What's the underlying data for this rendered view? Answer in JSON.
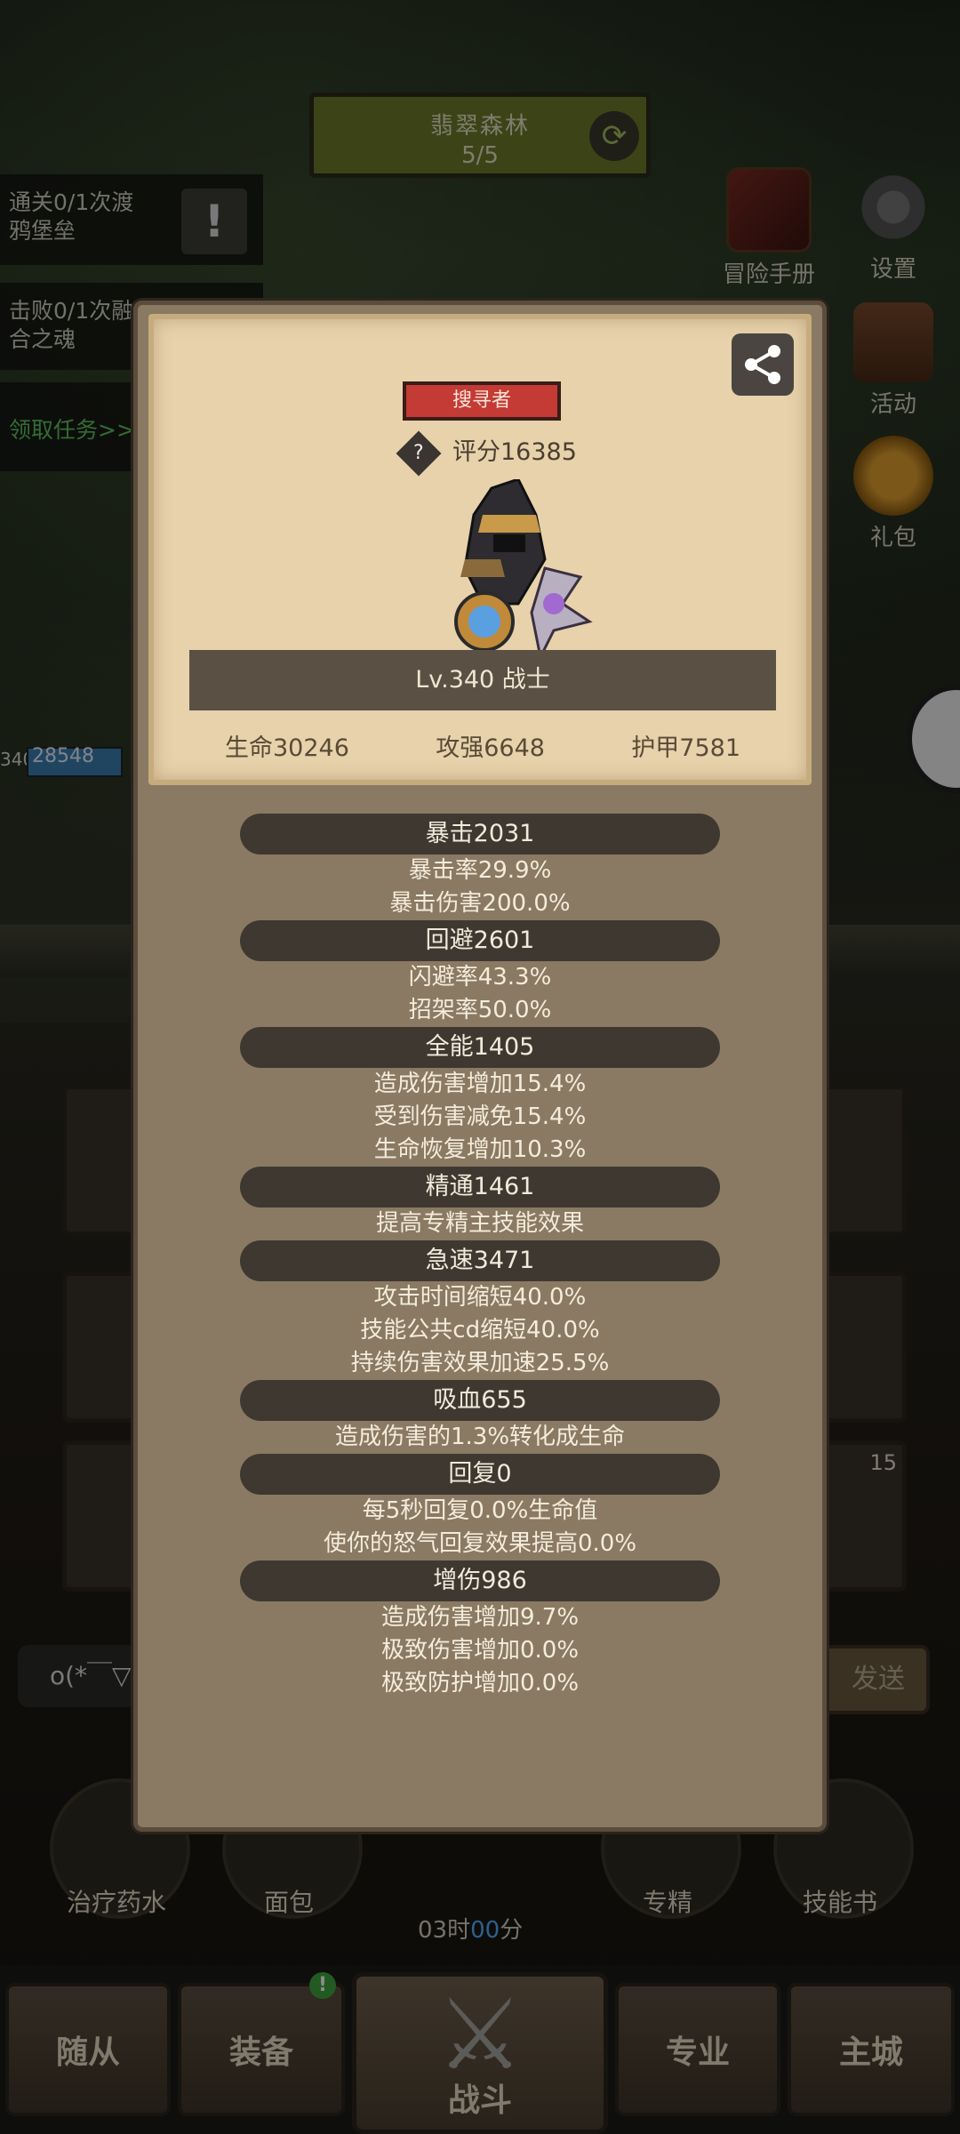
{
  "stage": {
    "name": "翡翠森林",
    "progress": "5/5"
  },
  "quests": [
    {
      "line1": "通关0/1次渡",
      "line2": "鸦堡垒"
    },
    {
      "line1": "击败0/1次融",
      "line2": "合之魂"
    }
  ],
  "quest_link": "领取任务>>",
  "right_icons": {
    "handbook": "冒险手册",
    "settings": "设置",
    "activity": "活动",
    "gift": "礼包"
  },
  "hero_hud": {
    "level": "340",
    "hp": "28548"
  },
  "chat": {
    "emoticon": "o(*￣▽",
    "send_label": "发送"
  },
  "items": [
    "治疗药水",
    "面包",
    "专精",
    "技能书"
  ],
  "timer": {
    "hours": "03时",
    "minutes": "00",
    "unit": "分"
  },
  "nav": {
    "followers": "随从",
    "equipment": "装备",
    "battle": "战斗",
    "profession": "专业",
    "city": "主城",
    "equipment_badge": "!"
  },
  "slot_count": "15",
  "modal": {
    "title_tag": "搜寻者",
    "score": "评分16385",
    "level_class": "Lv.340 战士",
    "base_stats": [
      "生命30246",
      "攻强6648",
      "护甲7581"
    ],
    "sections": [
      {
        "head": "暴击2031",
        "lines": [
          "暴击率29.9%",
          "暴击伤害200.0%"
        ]
      },
      {
        "head": "回避2601",
        "lines": [
          "闪避率43.3%",
          "招架率50.0%"
        ]
      },
      {
        "head": "全能1405",
        "lines": [
          "造成伤害增加15.4%",
          "受到伤害减免15.4%",
          "生命恢复增加10.3%"
        ]
      },
      {
        "head": "精通1461",
        "lines": [
          "提高专精主技能效果"
        ]
      },
      {
        "head": "急速3471",
        "lines": [
          "攻击时间缩短40.0%",
          "技能公共cd缩短40.0%",
          "持续伤害效果加速25.5%"
        ]
      },
      {
        "head": "吸血655",
        "lines": [
          "造成伤害的1.3%转化成生命"
        ]
      },
      {
        "head": "回复0",
        "lines": [
          "每5秒回复0.0%生命值",
          "使你的怒气回复效果提高0.0%"
        ]
      },
      {
        "head": "增伤986",
        "lines": [
          "造成伤害增加9.7%",
          "极致伤害增加0.0%",
          "极致防护增加0.0%"
        ]
      }
    ]
  }
}
